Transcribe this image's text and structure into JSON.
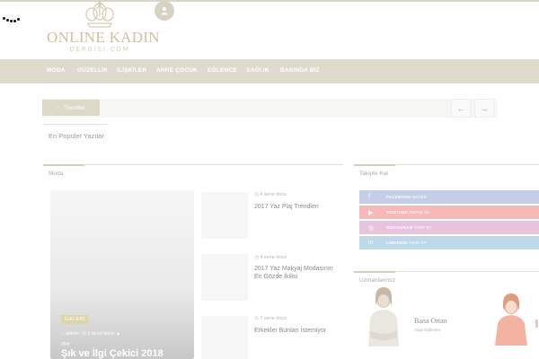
{
  "brand": {
    "logo_title": "ONLINE KADIN",
    "logo_sub": "DERGISI.COM",
    "colors": {
      "accent": "#dedbcc",
      "logo": "#c9c2a4"
    }
  },
  "header": {
    "user_icon": "user-icon",
    "loader_icon": "spinner-icon"
  },
  "nav": {
    "items": [
      {
        "label": "MODA"
      },
      {
        "label": "GÜZELLİK"
      },
      {
        "label": "İLİŞKİLER"
      },
      {
        "label": "ANNE ÇOCUK"
      },
      {
        "label": "EĞLENCE"
      },
      {
        "label": "SAĞLIK"
      },
      {
        "label": "BASINDA BİZ"
      }
    ]
  },
  "trending": {
    "label": "Trendler",
    "prev_icon": "arrow-left-icon",
    "next_icon": "arrow-right-icon"
  },
  "tabs": {
    "popular_authors": "En Popüler Yazılar"
  },
  "sections": {
    "moda": "Moda",
    "follow": "Takipte Kal",
    "experts": "Uzmanlarımız"
  },
  "featured": {
    "badge": "GALERİ",
    "author": "admin",
    "date": "3 sene önce",
    "count": "284",
    "title": "Şık ve İlgi Çekici 2018"
  },
  "posts": [
    {
      "date": "4 sene önce",
      "title": "2017 Yaz Plaj Trendleri"
    },
    {
      "date": "4 sene önce",
      "title": "2017 Yaz Makyaj Modasının En Gözde İkilisi"
    },
    {
      "date": "7 sene önce",
      "title": "Erkekler Bunları İstemiyor"
    }
  ],
  "social": [
    {
      "network": "FACEBOOK",
      "count": "BEĞEN",
      "icon": "facebook-icon",
      "color": "#c6cde6"
    },
    {
      "network": "YOUTUBE",
      "count": "ABONE OL",
      "icon": "youtube-icon",
      "color": "#f7b8b8"
    },
    {
      "network": "INSTAGRAM",
      "count": "TAKİP ET",
      "icon": "instagram-icon",
      "color": "#e6c4de"
    },
    {
      "network": "LINKEDIN",
      "count": "TAKİP ET",
      "icon": "linkedin-icon",
      "color": "#bfd8ea"
    }
  ],
  "experts": [
    {
      "name": "Bana Ortan",
      "role": "Yoga Eğitmeni"
    }
  ]
}
